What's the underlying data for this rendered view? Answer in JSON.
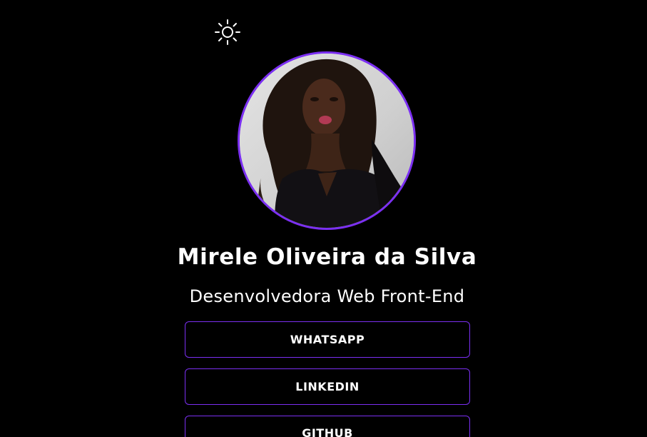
{
  "icons": {
    "theme_toggle": "sun-icon"
  },
  "colors": {
    "background": "#000000",
    "accent": "#7b2ff2",
    "text": "#ffffff"
  },
  "profile": {
    "name": "Mirele Oliveira da Silva",
    "title": "Desenvolvedora Web Front-End"
  },
  "links": [
    {
      "label": "WHATSAPP"
    },
    {
      "label": "LINKEDIN"
    },
    {
      "label": "GITHUB"
    }
  ]
}
